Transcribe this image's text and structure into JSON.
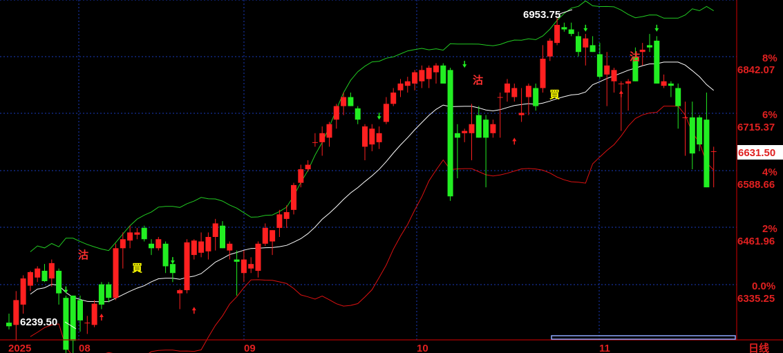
{
  "chart_data": {
    "type": "candlestick",
    "period_label": "日线",
    "price_ticks": [
      "6842.07",
      "6715.37",
      "6588.66",
      "6461.96",
      "6335.25"
    ],
    "pct_ticks": [
      "8%",
      "6%",
      "4%",
      "2%",
      "0.0%"
    ],
    "current_price": "6631.50",
    "max_label": "6953.75",
    "min_label": "6239.50",
    "x_ticks": [
      "2025",
      "08",
      "09",
      "10",
      "11"
    ],
    "signals": [
      {
        "text": "沽",
        "color": "#ff3030"
      },
      {
        "text": "買",
        "color": "#ffff00"
      },
      {
        "text": "沽",
        "color": "#ff3030"
      },
      {
        "text": "買",
        "color": "#ffff00"
      },
      {
        "text": "沽",
        "color": "#ff3030"
      }
    ],
    "colors": {
      "up": "#ff2020",
      "down": "#22ee22",
      "mid": "#ffffff",
      "upper": "#22cc22",
      "lower": "#dd1111",
      "grid": "#1a3cc0",
      "axis": "#b00000"
    },
    "ohlc": [
      [
        6280,
        6300,
        6265,
        6272
      ],
      [
        6275,
        6350,
        6240,
        6330
      ],
      [
        6320,
        6385,
        6300,
        6378
      ],
      [
        6362,
        6395,
        6350,
        6392
      ],
      [
        6380,
        6405,
        6370,
        6400
      ],
      [
        6395,
        6410,
        6370,
        6372
      ],
      [
        6378,
        6420,
        6360,
        6412
      ],
      [
        6395,
        6400,
        6320,
        6345
      ],
      [
        6335,
        6340,
        6200,
        6220
      ],
      [
        6340,
        6340,
        6210,
        6240
      ],
      [
        6330,
        6340,
        6260,
        6285
      ],
      [
        6280,
        6295,
        6255,
        6280
      ],
      [
        6275,
        6330,
        6270,
        6322
      ],
      [
        6365,
        6370,
        6310,
        6320
      ],
      [
        6365,
        6370,
        6325,
        6335
      ],
      [
        6335,
        6455,
        6330,
        6445
      ],
      [
        6445,
        6480,
        6400,
        6465
      ],
      [
        6462,
        6495,
        6445,
        6480
      ],
      [
        6475,
        6490,
        6465,
        6480
      ],
      [
        6490,
        6495,
        6460,
        6465
      ],
      [
        6455,
        6465,
        6430,
        6445
      ],
      [
        6445,
        6470,
        6440,
        6465
      ],
      [
        6455,
        6460,
        6390,
        6405
      ],
      [
        6410,
        6425,
        6370,
        6390
      ],
      [
        6345,
        6355,
        6310,
        6352
      ],
      [
        6352,
        6465,
        6345,
        6458
      ],
      [
        6430,
        6465,
        6420,
        6462
      ],
      [
        6435,
        6480,
        6425,
        6460
      ],
      [
        6438,
        6480,
        6420,
        6470
      ],
      [
        6470,
        6510,
        6440,
        6500
      ],
      [
        6495,
        6505,
        6445,
        6445
      ],
      [
        6440,
        6460,
        6420,
        6455
      ],
      [
        6420,
        6440,
        6340,
        6415
      ],
      [
        6390,
        6440,
        6370,
        6420
      ],
      [
        6400,
        6425,
        6390,
        6410
      ],
      [
        6395,
        6460,
        6380,
        6455
      ],
      [
        6455,
        6500,
        6450,
        6490
      ],
      [
        6460,
        6485,
        6430,
        6485
      ],
      [
        6490,
        6530,
        6470,
        6520
      ],
      [
        6510,
        6540,
        6490,
        6525
      ],
      [
        6530,
        6590,
        6520,
        6585
      ],
      [
        6590,
        6630,
        6580,
        6620
      ],
      [
        6620,
        6640,
        6615,
        6630
      ],
      [
        6680,
        6700,
        6670,
        6680
      ],
      [
        6680,
        6715,
        6650,
        6700
      ],
      [
        6690,
        6725,
        6670,
        6720
      ],
      [
        6730,
        6765,
        6710,
        6760
      ],
      [
        6760,
        6790,
        6740,
        6780
      ],
      [
        6780,
        6790,
        6760,
        6760
      ],
      [
        6755,
        6760,
        6720,
        6730
      ],
      [
        6670,
        6720,
        6640,
        6715
      ],
      [
        6675,
        6720,
        6660,
        6710
      ],
      [
        6680,
        6715,
        6665,
        6700
      ],
      [
        6725,
        6780,
        6720,
        6765
      ],
      [
        6765,
        6800,
        6760,
        6790
      ],
      [
        6795,
        6820,
        6780,
        6810
      ],
      [
        6805,
        6825,
        6790,
        6815
      ],
      [
        6810,
        6840,
        6795,
        6835
      ],
      [
        6815,
        6850,
        6800,
        6840
      ],
      [
        6820,
        6850,
        6800,
        6845
      ],
      [
        6835,
        6855,
        6810,
        6850
      ],
      [
        6850,
        6855,
        6810,
        6810
      ],
      [
        6840,
        6845,
        6550,
        6560
      ],
      [
        6700,
        6720,
        6600,
        6690
      ],
      [
        6700,
        6710,
        6680,
        6705
      ],
      [
        6700,
        6765,
        6640,
        6720
      ],
      [
        6740,
        6760,
        6690,
        6690
      ],
      [
        6730,
        6740,
        6580,
        6690
      ],
      [
        6700,
        6730,
        6690,
        6720
      ],
      [
        6780,
        6790,
        6690,
        6780
      ],
      [
        6790,
        6820,
        6770,
        6810
      ],
      [
        6780,
        6810,
        6770,
        6800
      ],
      [
        6740,
        6800,
        6725,
        6745
      ],
      [
        6780,
        6810,
        6740,
        6805
      ],
      [
        6800,
        6810,
        6750,
        6760
      ],
      [
        6800,
        6895,
        6790,
        6865
      ],
      [
        6870,
        6910,
        6860,
        6905
      ],
      [
        6900,
        6955,
        6895,
        6940
      ],
      [
        6935,
        6945,
        6925,
        6930
      ],
      [
        6930,
        6945,
        6915,
        6920
      ],
      [
        6915,
        6925,
        6870,
        6880
      ],
      [
        6890,
        6920,
        6850,
        6910
      ],
      [
        6895,
        6915,
        6880,
        6880
      ],
      [
        6875,
        6900,
        6820,
        6825
      ],
      [
        6830,
        6880,
        6760,
        6850
      ],
      [
        6815,
        6845,
        6790,
        6840
      ],
      [
        6810,
        6815,
        6705,
        6810
      ],
      [
        6810,
        6820,
        6750,
        6815
      ],
      [
        6870,
        6890,
        6815,
        6815
      ],
      [
        6880,
        6900,
        6850,
        6885
      ],
      [
        6895,
        6920,
        6880,
        6890
      ],
      [
        6905,
        6915,
        6810,
        6810
      ],
      [
        6805,
        6830,
        6800,
        6815
      ],
      [
        6810,
        6815,
        6780,
        6805
      ],
      [
        6800,
        6810,
        6710,
        6760
      ],
      [
        6735,
        6770,
        6650,
        6735
      ],
      [
        6735,
        6770,
        6620,
        6655
      ],
      [
        6735,
        6740,
        6660,
        6675
      ],
      [
        6730,
        6790,
        6580,
        6580
      ],
      [
        6660,
        6670,
        6580,
        6660
      ]
    ]
  }
}
